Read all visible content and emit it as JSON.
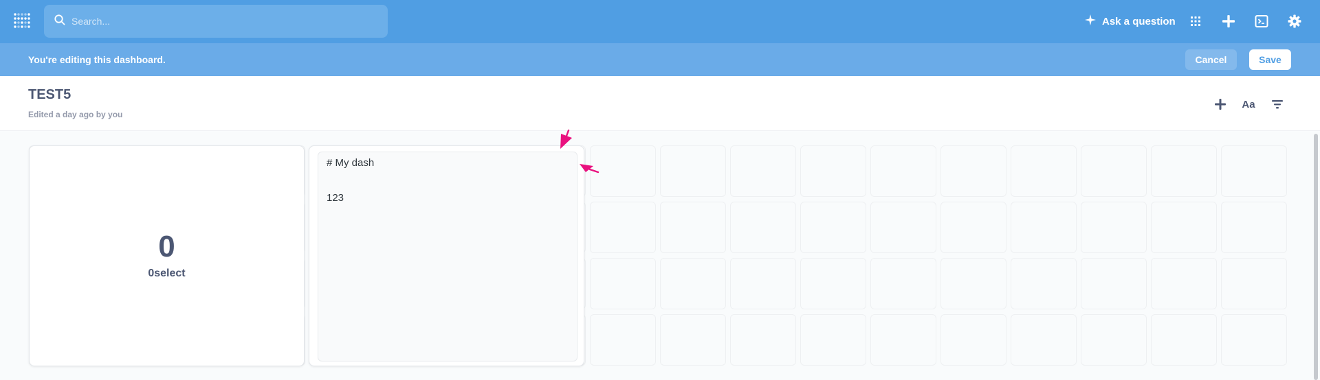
{
  "nav": {
    "search_placeholder": "Search...",
    "ask_label": "Ask a question",
    "icons": [
      "metabase-logo-icon",
      "search-icon",
      "sparkle-icon",
      "apps-grid-icon",
      "plus-icon",
      "sql-editor-icon",
      "gear-icon"
    ]
  },
  "editbar": {
    "message": "You're editing this dashboard.",
    "cancel_label": "Cancel",
    "save_label": "Save"
  },
  "header": {
    "title": "TEST5",
    "subtitle": "Edited a day ago by you",
    "text_icon_label": "Aa",
    "icons": [
      "add-card-icon",
      "text-card-icon",
      "filter-icon"
    ]
  },
  "cards": {
    "scalar": {
      "value": "0",
      "label": "0select"
    },
    "text": {
      "heading": "# My dash",
      "body": "123"
    }
  },
  "colors": {
    "brand": "#509ee3",
    "editbar": "#6aabe8",
    "annotation": "#e9117f",
    "text_dark": "#4c5773"
  }
}
